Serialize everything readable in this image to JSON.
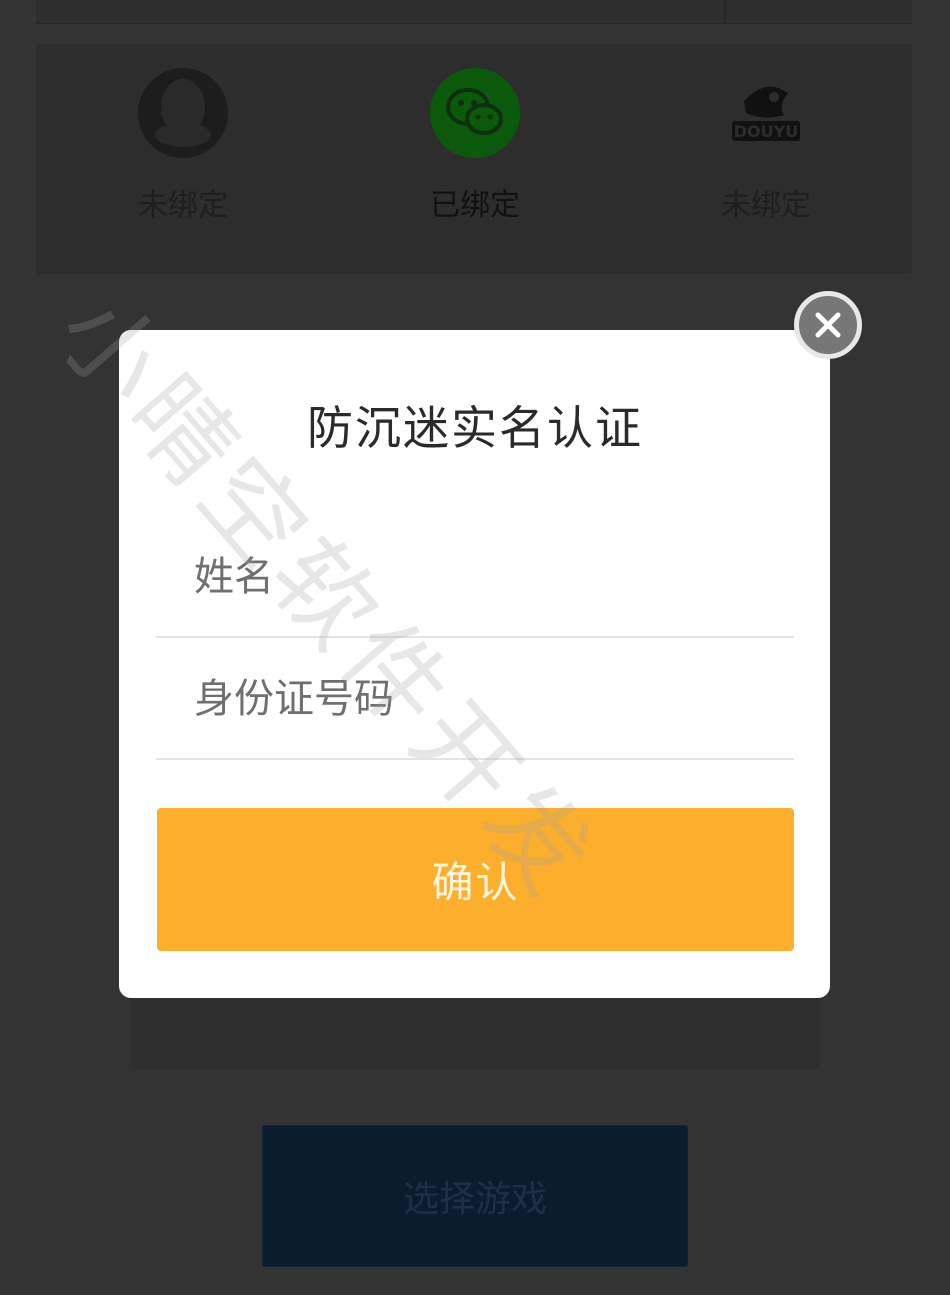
{
  "bindings": [
    {
      "platform": "qq",
      "icon": "qq-penguin-icon",
      "status": "未绑定"
    },
    {
      "platform": "wechat",
      "icon": "wechat-icon",
      "status": "已绑定"
    },
    {
      "platform": "douyu",
      "icon": "douyu-logo-icon",
      "status": "未绑定"
    }
  ],
  "modal": {
    "title": "防沉迷实名认证",
    "name_placeholder": "姓名",
    "id_placeholder": "身份证号码",
    "confirm_label": "确认"
  },
  "select_game_label": "选择游戏",
  "watermark": "小晴空软件开发",
  "colors": {
    "confirm": "#fcae2d",
    "select_game_bg": "#0a1c2d",
    "wechat_green": "#0b5a0b",
    "overlay": "#333333"
  }
}
